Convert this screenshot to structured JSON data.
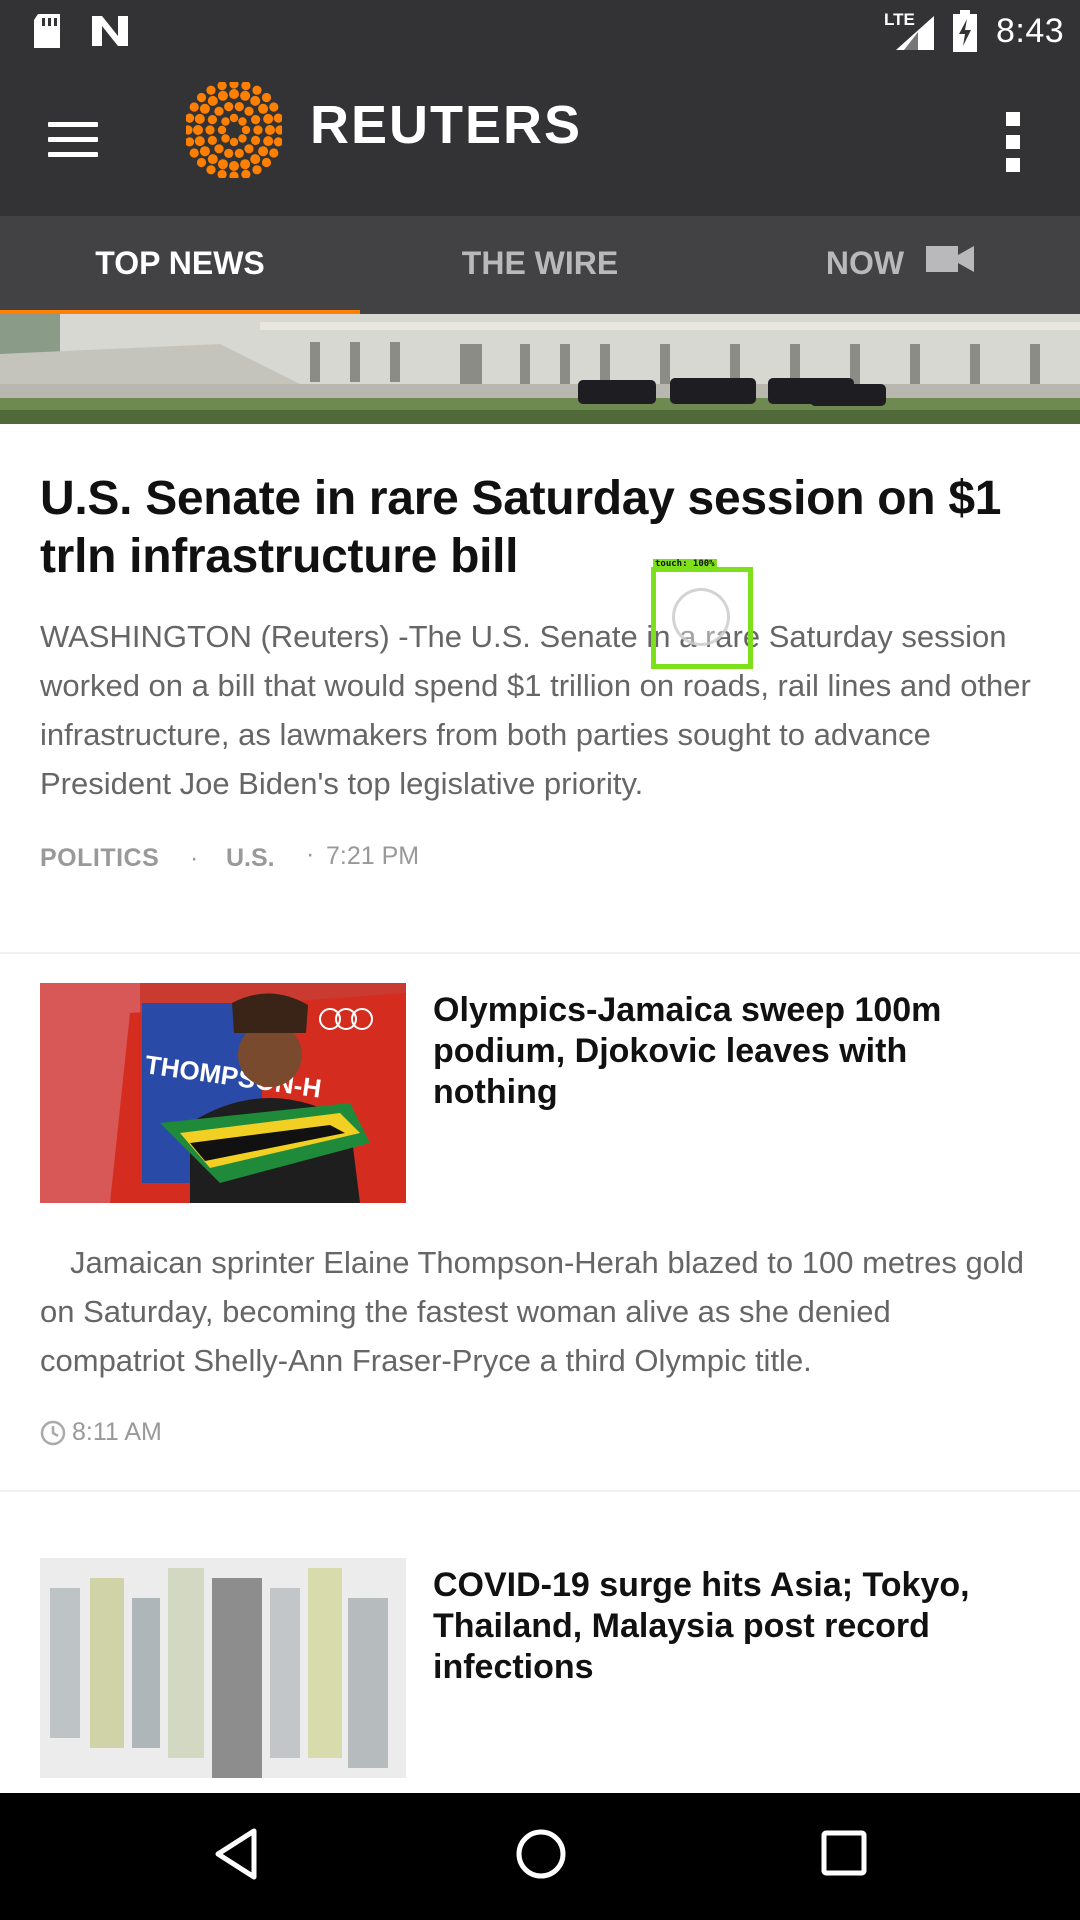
{
  "status_bar": {
    "network": "LTE",
    "time": "8:43",
    "icons": [
      "sd-card-icon",
      "n-icon",
      "signal-icon",
      "battery-charging-icon"
    ]
  },
  "app_bar": {
    "logo_text": "REUTERS",
    "brand_color": "#ff8000",
    "icons": [
      "menu-icon",
      "reuters-logo-icon",
      "more-vert-icon"
    ]
  },
  "tabs": [
    {
      "label": "TOP NEWS",
      "active": true
    },
    {
      "label": "THE WIRE",
      "active": false
    },
    {
      "label": "NOW",
      "active": false,
      "icon": "video-camera-icon"
    }
  ],
  "articles": [
    {
      "headline": "U.S. Senate in rare Saturday session on $1 trln infrastructure bill",
      "summary": "WASHINGTON (Reuters) -The U.S. Senate in a rare Saturday session worked on a bill that would spend $1 trillion on roads, rail lines and other infrastructure, as lawmakers from both parties sought to advance President Joe Biden's top legislative priority.",
      "category1": "POLITICS",
      "category2": "U.S.",
      "separator": "·",
      "time": "7:21 PM"
    },
    {
      "headline": "Olympics-Jamaica sweep 100m podium, Djokovic leaves with nothing",
      "summary": "Jamaican sprinter Elaine Thompson-Herah blazed to 100 metres gold on Saturday, becoming the fastest woman alive as she denied compatriot Shelly-Ann Fraser-Pryce a third Olympic title.",
      "time": "8:11 AM",
      "thumbnail_text": "THOMPSON-H"
    },
    {
      "headline": "COVID-19 surge hits Asia; Tokyo, Thailand, Malaysia post record infections"
    }
  ],
  "touch_overlay": {
    "label": "touch: 100%"
  },
  "nav_bar": {
    "icons": [
      "back-icon",
      "home-icon",
      "recents-icon"
    ]
  }
}
